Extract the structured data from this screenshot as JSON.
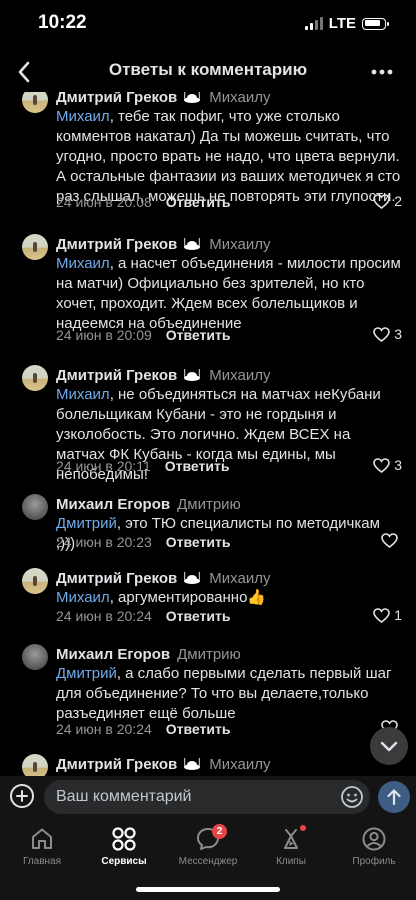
{
  "status": {
    "time": "10:22",
    "network": "LTE"
  },
  "header": {
    "title": "Ответы к комментарию"
  },
  "comments": [
    {
      "author": "Дмитрий Греков",
      "reply_to": "Михаилу",
      "mention": "Михаил",
      "text": ", тебе так пофиг, что уже столько комментов накатал) Да ты можешь считать, что угодно, просто врать не надо, что цвета вернули. А остальные фантазии из ваших методичек я сто раз слышал, можешь не повторять эти глупости.",
      "date": "24 июн в 20:08",
      "reply_label": "Ответить",
      "likes": "2"
    },
    {
      "author": "Дмитрий Греков",
      "reply_to": "Михаилу",
      "mention": "Михаил",
      "text": ", а насчет объединения - милости просим на матчи) Официально без зрителей, но кто хочет, проходит. Ждем всех болельщиков и надеемся на объединение",
      "date": "24 июн в 20:09",
      "reply_label": "Ответить",
      "likes": "3"
    },
    {
      "author": "Дмитрий Греков",
      "reply_to": "Михаилу",
      "mention": "Михаил",
      "text": ", не объединяться на матчах неКубани болельщикам Кубани - это не гордыня и узколобость. Это логично. Ждем ВСЕХ на матчах ФК Кубань - когда мы едины, мы непобедимы!",
      "date": "24 июн в 20:11",
      "reply_label": "Ответить",
      "likes": "3"
    },
    {
      "author": "Михаил Егоров",
      "reply_to": "Дмитрию",
      "mention": "Дмитрий",
      "text": ", это ТЮ специалисты по методичкам ;)))",
      "date": "24 июн в 20:23",
      "reply_label": "Ответить",
      "likes": ""
    },
    {
      "author": "Дмитрий Греков",
      "reply_to": "Михаилу",
      "mention": "Михаил",
      "text": ", аргументированно👍",
      "date": "24 июн в 20:24",
      "reply_label": "Ответить",
      "likes": "1"
    },
    {
      "author": "Михаил Егоров",
      "reply_to": "Дмитрию",
      "mention": "Дмитрий",
      "text": ", а слабо первыми сделать первый шаг для объединение? То что вы делаете,только разъединяет ещё больше",
      "date": "24 июн в 20:24",
      "reply_label": "Ответить",
      "likes": ""
    },
    {
      "author": "Дмитрий Греков",
      "reply_to": "Михаилу",
      "mention": "",
      "text": "",
      "date": "",
      "reply_label": "",
      "likes": ""
    }
  ],
  "compose": {
    "placeholder": "Ваш комментарий"
  },
  "tabbar": {
    "home": "Главная",
    "services": "Сервисы",
    "messenger": "Мессенджер",
    "messenger_badge": "2",
    "clips": "Клипы",
    "profile": "Профиль"
  },
  "colors": {
    "accent": "#71aaeb",
    "badge": "#e64646",
    "background": "#000000"
  }
}
